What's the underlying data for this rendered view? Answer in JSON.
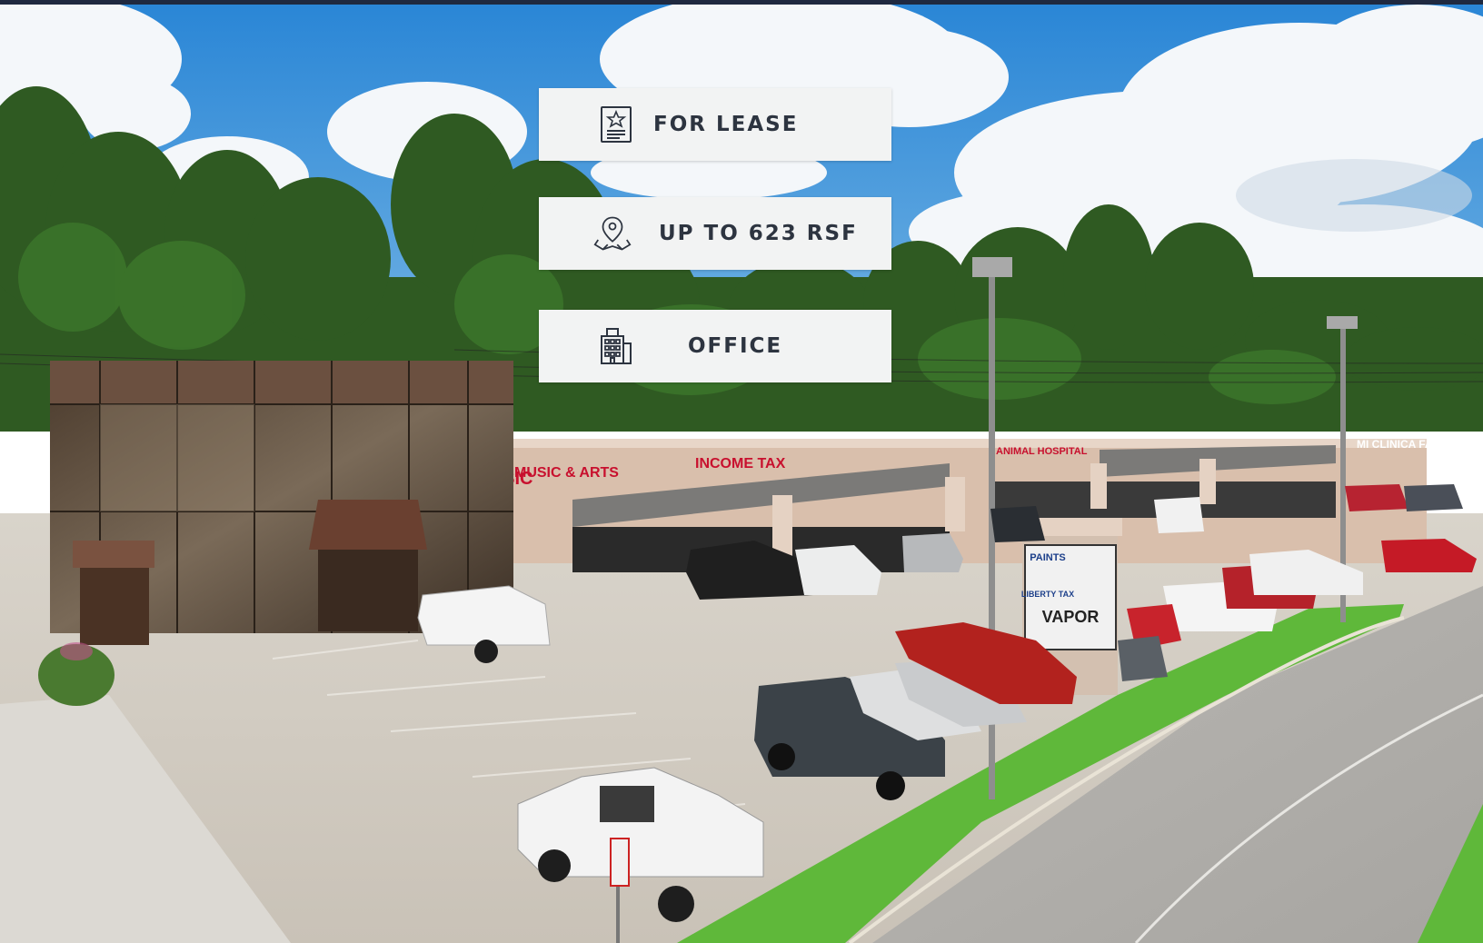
{
  "badges": {
    "lease": {
      "label": "FOR LEASE",
      "icon": "star-document-icon"
    },
    "size": {
      "label": "UP TO 623 RSF",
      "icon": "map-pin-icon"
    },
    "type": {
      "label": "OFFICE",
      "icon": "office-building-icon"
    }
  },
  "photo": {
    "sign_music": "MUSIC",
    "sign_music_arts": "MUSIC & ARTS",
    "sign_income_tax": "INCOME TAX",
    "sign_animal_hospital": "ANIMAL HOSPITAL",
    "sign_clinica": "MI CLINICA FAMILIAR",
    "sign_vapor": "VAPOR",
    "sign_liberty_tax": "LIBERTY TAX",
    "sign_paints": "PAINTS"
  },
  "colors": {
    "topbar": "#1f2940",
    "badge_bg": "#f2f3f3",
    "badge_text": "#2d3440",
    "sky": "#3f95d8",
    "grass": "#5fb83a"
  }
}
